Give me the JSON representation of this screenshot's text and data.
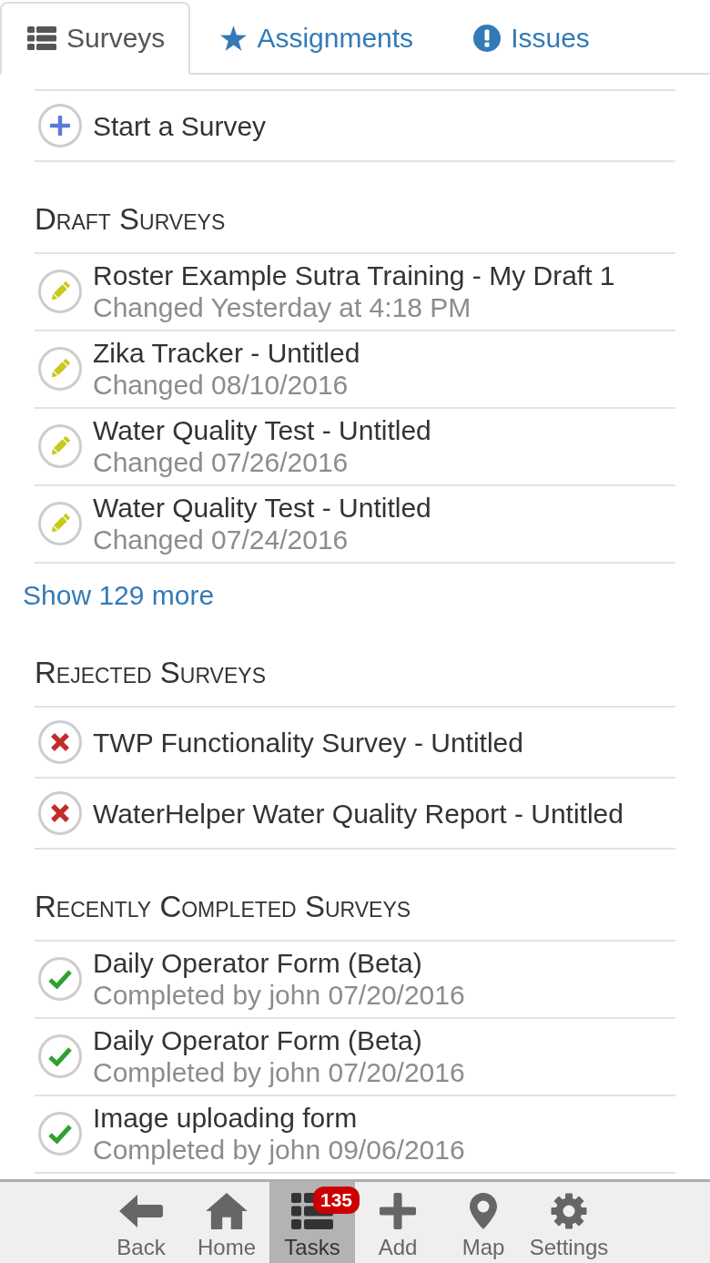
{
  "tabs": [
    {
      "label": "Surveys",
      "selected": true
    },
    {
      "label": "Assignments",
      "selected": false
    },
    {
      "label": "Issues",
      "selected": false
    }
  ],
  "start_item": {
    "label": "Start a Survey"
  },
  "sections": [
    {
      "heading": "Draft Surveys",
      "items": [
        {
          "kind": "draft",
          "title": "Roster Example Sutra Training - My Draft 1",
          "subtitle": "Changed Yesterday at 4:18 PM"
        },
        {
          "kind": "draft",
          "title": "Zika Tracker - Untitled",
          "subtitle": "Changed 08/10/2016"
        },
        {
          "kind": "draft",
          "title": "Water Quality Test - Untitled",
          "subtitle": "Changed 07/26/2016"
        },
        {
          "kind": "draft",
          "title": "Water Quality Test - Untitled",
          "subtitle": "Changed 07/24/2016"
        }
      ],
      "more_link": "Show 129 more"
    },
    {
      "heading": "Rejected Surveys",
      "items": [
        {
          "kind": "rejected",
          "title": "TWP Functionality Survey - Untitled"
        },
        {
          "kind": "rejected",
          "title": "WaterHelper Water Quality Report - Untitled"
        }
      ]
    },
    {
      "heading": "Recently Completed Surveys",
      "items": [
        {
          "kind": "completed",
          "title": "Daily Operator Form (Beta)",
          "subtitle": "Completed by john 07/20/2016"
        },
        {
          "kind": "completed",
          "title": "Daily Operator Form (Beta)",
          "subtitle": "Completed by john 07/20/2016"
        },
        {
          "kind": "completed",
          "title": "Image uploading form",
          "subtitle": "Completed by john 09/06/2016"
        }
      ]
    }
  ],
  "bottom_nav": [
    {
      "label": "Back",
      "selected": false
    },
    {
      "label": "Home",
      "selected": false
    },
    {
      "label": "Tasks",
      "selected": true,
      "badge": "135"
    },
    {
      "label": "Add",
      "selected": false
    },
    {
      "label": "Map",
      "selected": false
    },
    {
      "label": "Settings",
      "selected": false
    }
  ]
}
